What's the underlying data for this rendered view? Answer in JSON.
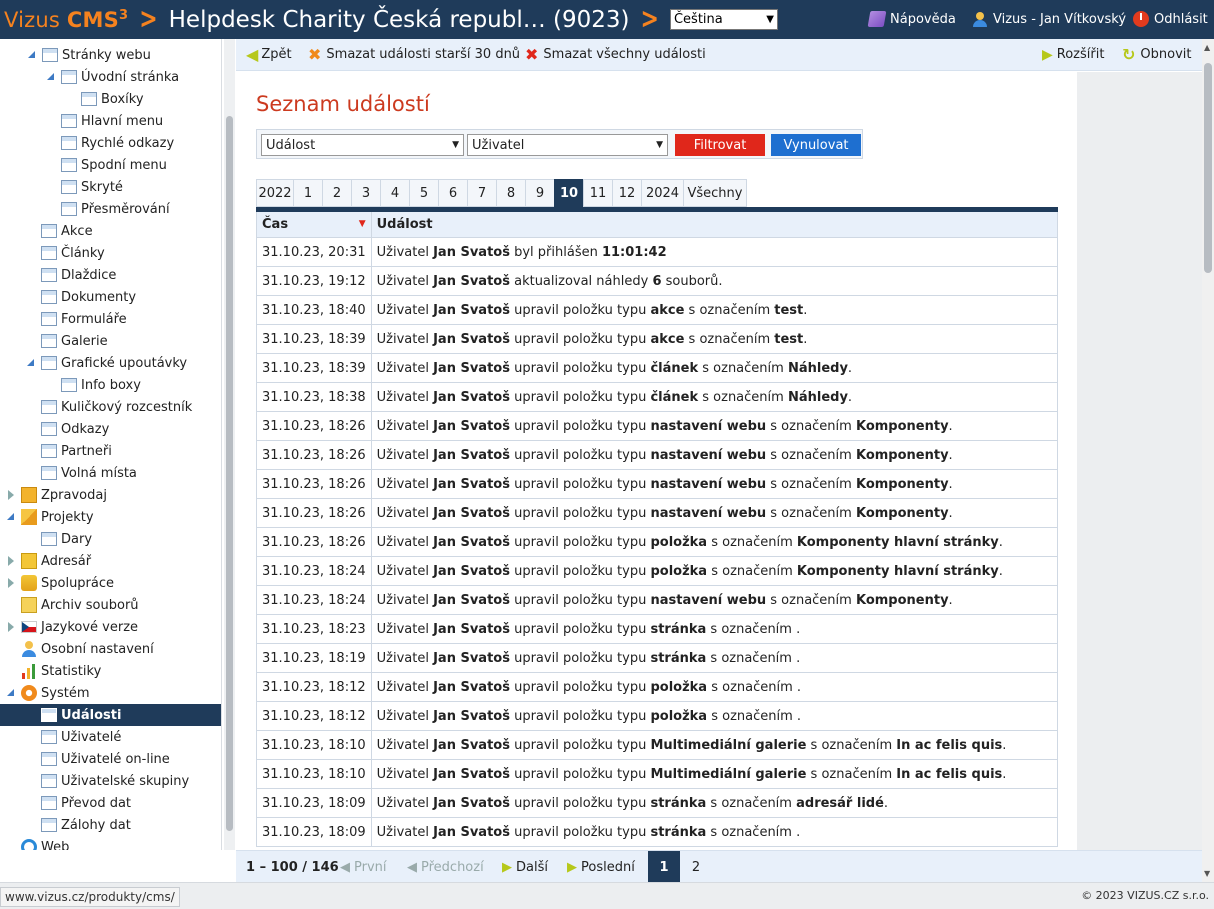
{
  "header": {
    "logo_vizus": "Vizus",
    "logo_cms": "CMS",
    "logo_sup": "3",
    "site_title": "Helpdesk Charity Česká republ… (9023)",
    "language": "Čeština",
    "help": "Nápověda",
    "user": "Vizus - Jan Vítkovský",
    "logout": "Odhlásit"
  },
  "sidebar": {
    "items": [
      {
        "label": "Stránky webu"
      },
      {
        "label": "Úvodní stránka"
      },
      {
        "label": "Boxíky"
      },
      {
        "label": "Hlavní menu"
      },
      {
        "label": "Rychlé odkazy"
      },
      {
        "label": "Spodní menu"
      },
      {
        "label": "Skryté"
      },
      {
        "label": "Přesměrování"
      },
      {
        "label": "Akce"
      },
      {
        "label": "Články"
      },
      {
        "label": "Dlaždice"
      },
      {
        "label": "Dokumenty"
      },
      {
        "label": "Formuláře"
      },
      {
        "label": "Galerie"
      },
      {
        "label": "Grafické upoutávky"
      },
      {
        "label": "Info boxy"
      },
      {
        "label": "Kuličkový rozcestník"
      },
      {
        "label": "Odkazy"
      },
      {
        "label": "Partneři"
      },
      {
        "label": "Volná místa"
      },
      {
        "label": "Zpravodaj"
      },
      {
        "label": "Projekty"
      },
      {
        "label": "Dary"
      },
      {
        "label": "Adresář"
      },
      {
        "label": "Spolupráce"
      },
      {
        "label": "Archiv souborů"
      },
      {
        "label": "Jazykové verze"
      },
      {
        "label": "Osobní nastavení"
      },
      {
        "label": "Statistiky"
      },
      {
        "label": "Systém"
      },
      {
        "label": "Události"
      },
      {
        "label": "Uživatelé"
      },
      {
        "label": "Uživatelé on-line"
      },
      {
        "label": "Uživatelské skupiny"
      },
      {
        "label": "Převod dat"
      },
      {
        "label": "Zálohy dat"
      },
      {
        "label": "Web"
      }
    ]
  },
  "toolbar": {
    "back": "Zpět",
    "delete_old": "Smazat události starší 30 dnů",
    "delete_all": "Smazat všechny události",
    "expand": "Rozšířit",
    "refresh": "Obnovit"
  },
  "page_title": "Seznam událostí",
  "filter": {
    "event_select": "Událost",
    "user_select": "Uživatel",
    "filter_button": "Filtrovat",
    "reset_button": "Vynulovat"
  },
  "tabs": [
    "2022",
    "1",
    "2",
    "3",
    "4",
    "5",
    "6",
    "7",
    "8",
    "9",
    "10",
    "11",
    "12",
    "2024",
    "Všechny"
  ],
  "active_tab": "10",
  "table": {
    "headers": {
      "time": "Čas",
      "event": "Událost"
    },
    "rows": [
      {
        "time": "31.10.23, 20:31",
        "parts": [
          "Uživatel ",
          "Jan Svatoš",
          " byl přihlášen ",
          "11:01:42",
          ""
        ]
      },
      {
        "time": "31.10.23, 19:12",
        "parts": [
          "Uživatel ",
          "Jan Svatoš",
          " aktualizoval náhledy ",
          "6",
          " souborů."
        ]
      },
      {
        "time": "31.10.23, 18:40",
        "parts": [
          "Uživatel ",
          "Jan Svatoš",
          " upravil položku typu ",
          "akce",
          " s označením ",
          "test",
          "."
        ]
      },
      {
        "time": "31.10.23, 18:39",
        "parts": [
          "Uživatel ",
          "Jan Svatoš",
          " upravil položku typu ",
          "akce",
          " s označením ",
          "test",
          "."
        ]
      },
      {
        "time": "31.10.23, 18:39",
        "parts": [
          "Uživatel ",
          "Jan Svatoš",
          " upravil položku typu ",
          "článek",
          " s označením ",
          "Náhledy",
          "."
        ]
      },
      {
        "time": "31.10.23, 18:38",
        "parts": [
          "Uživatel ",
          "Jan Svatoš",
          " upravil položku typu ",
          "článek",
          " s označením ",
          "Náhledy",
          "."
        ]
      },
      {
        "time": "31.10.23, 18:26",
        "parts": [
          "Uživatel ",
          "Jan Svatoš",
          " upravil položku typu ",
          "nastavení webu",
          " s označením ",
          "Komponenty",
          "."
        ]
      },
      {
        "time": "31.10.23, 18:26",
        "parts": [
          "Uživatel ",
          "Jan Svatoš",
          " upravil položku typu ",
          "nastavení webu",
          " s označením ",
          "Komponenty",
          "."
        ]
      },
      {
        "time": "31.10.23, 18:26",
        "parts": [
          "Uživatel ",
          "Jan Svatoš",
          " upravil položku typu ",
          "nastavení webu",
          " s označením ",
          "Komponenty",
          "."
        ]
      },
      {
        "time": "31.10.23, 18:26",
        "parts": [
          "Uživatel ",
          "Jan Svatoš",
          " upravil položku typu ",
          "nastavení webu",
          " s označením ",
          "Komponenty",
          "."
        ]
      },
      {
        "time": "31.10.23, 18:26",
        "parts": [
          "Uživatel ",
          "Jan Svatoš",
          " upravil položku typu ",
          "položka",
          " s označením ",
          "Komponenty hlavní stránky",
          "."
        ]
      },
      {
        "time": "31.10.23, 18:24",
        "parts": [
          "Uživatel ",
          "Jan Svatoš",
          " upravil položku typu ",
          "položka",
          " s označením ",
          "Komponenty hlavní stránky",
          "."
        ]
      },
      {
        "time": "31.10.23, 18:24",
        "parts": [
          "Uživatel ",
          "Jan Svatoš",
          " upravil položku typu ",
          "nastavení webu",
          " s označením ",
          "Komponenty",
          "."
        ]
      },
      {
        "time": "31.10.23, 18:23",
        "parts": [
          "Uživatel ",
          "Jan Svatoš",
          " upravil položku typu ",
          "stránka",
          " s označením ",
          "",
          " ."
        ]
      },
      {
        "time": "31.10.23, 18:19",
        "parts": [
          "Uživatel ",
          "Jan Svatoš",
          " upravil položku typu ",
          "stránka",
          " s označením ",
          "",
          " ."
        ]
      },
      {
        "time": "31.10.23, 18:12",
        "parts": [
          "Uživatel ",
          "Jan Svatoš",
          " upravil položku typu ",
          "položka",
          " s označením ",
          "",
          " ."
        ]
      },
      {
        "time": "31.10.23, 18:12",
        "parts": [
          "Uživatel ",
          "Jan Svatoš",
          " upravil položku typu ",
          "položka",
          " s označením ",
          "",
          " ."
        ]
      },
      {
        "time": "31.10.23, 18:10",
        "parts": [
          "Uživatel ",
          "Jan Svatoš",
          " upravil položku typu ",
          "Multimediální galerie",
          " s označením ",
          "In ac felis quis",
          "."
        ]
      },
      {
        "time": "31.10.23, 18:10",
        "parts": [
          "Uživatel ",
          "Jan Svatoš",
          " upravil položku typu ",
          "Multimediální galerie",
          " s označením ",
          "In ac felis quis",
          "."
        ]
      },
      {
        "time": "31.10.23, 18:09",
        "parts": [
          "Uživatel ",
          "Jan Svatoš",
          " upravil položku typu ",
          "stránka",
          " s označením ",
          "adresář lidé",
          "."
        ]
      },
      {
        "time": "31.10.23, 18:09",
        "parts": [
          "Uživatel ",
          "Jan Svatoš",
          " upravil položku typu ",
          "stránka",
          " s označením ",
          "",
          " ."
        ]
      }
    ]
  },
  "pager": {
    "range": "1 – 100 / 146",
    "first": "První",
    "prev": "Předchozí",
    "next": "Další",
    "last": "Poslední",
    "page1": "1",
    "page2": "2"
  },
  "footer": {
    "status": "www.vizus.cz/produkty/cms/",
    "copyright": "© 2023 VIZUS.CZ s.r.o."
  },
  "colors": {
    "header_bg": "#1f3b5a",
    "accent_orange": "#f5821f",
    "title_red": "#cc3a1f",
    "filter_red": "#e0271b",
    "reset_blue": "#1e6fd0"
  }
}
